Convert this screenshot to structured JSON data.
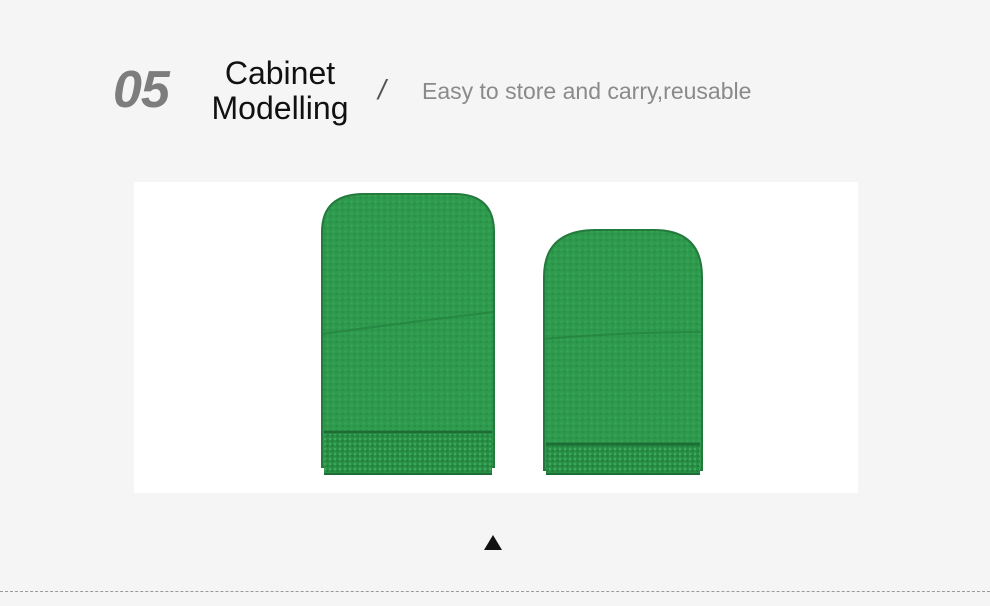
{
  "header": {
    "number": "05",
    "title_line1": "Cabinet",
    "title_line2": "Modelling",
    "separator": "/",
    "subtitle": "Easy to store and carry,reusable"
  },
  "colors": {
    "background": "#f5f5f5",
    "number": "#7d7d7d",
    "title": "#111111",
    "subtitle": "#8a8a8a",
    "mitt_green": "#2f9a4e"
  },
  "photo": {
    "subject": "two green microfiber cleaning mitts"
  },
  "footer": {
    "indicator": "up-triangle-icon"
  }
}
